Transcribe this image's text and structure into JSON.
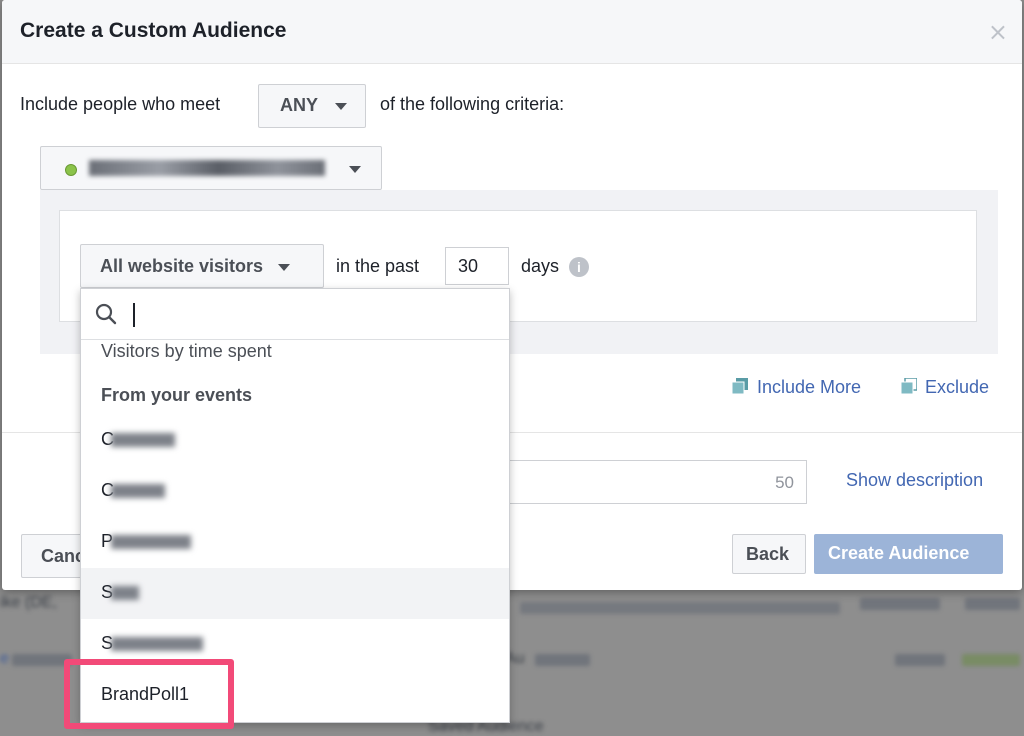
{
  "dialog": {
    "title": "Create a Custom Audience",
    "close_symbol": "×"
  },
  "criteria": {
    "prefix": "Include people who meet",
    "match_value": "ANY",
    "suffix": "of the following criteria:"
  },
  "rule": {
    "visitor_type": "All website visitors",
    "in_the_past": "in the past",
    "days_value": "30",
    "days_unit": "days",
    "info_symbol": "i"
  },
  "actions": {
    "include_more": "Include More",
    "exclude": "Exclude"
  },
  "description": {
    "char_count": "50",
    "show_description": "Show description"
  },
  "footer": {
    "cancel_partial": "Canc",
    "back": "Back",
    "create": "Create Audience"
  },
  "dropdown": {
    "search_value": "",
    "items": [
      {
        "label": "Visitors by time spent"
      },
      {
        "label": "From your events",
        "type": "header"
      },
      {
        "label": "C",
        "obscured": true
      },
      {
        "label": "C",
        "obscured": true
      },
      {
        "label": "P",
        "obscured": true
      },
      {
        "label": "S",
        "obscured": true
      },
      {
        "label": "S",
        "obscured": true
      },
      {
        "label": "BrandPoll1",
        "highlighted": true
      }
    ]
  },
  "background": {
    "row1_left": "ike (DE,",
    "row2_left": "e",
    "row2_mid": "Au",
    "row3_mid": "Saved Audience"
  },
  "colors": {
    "accent": "#4267b2",
    "primary_disabled": "#9cb4d8",
    "highlight": "#f24a78",
    "pixel_status": "#8bc34a"
  }
}
